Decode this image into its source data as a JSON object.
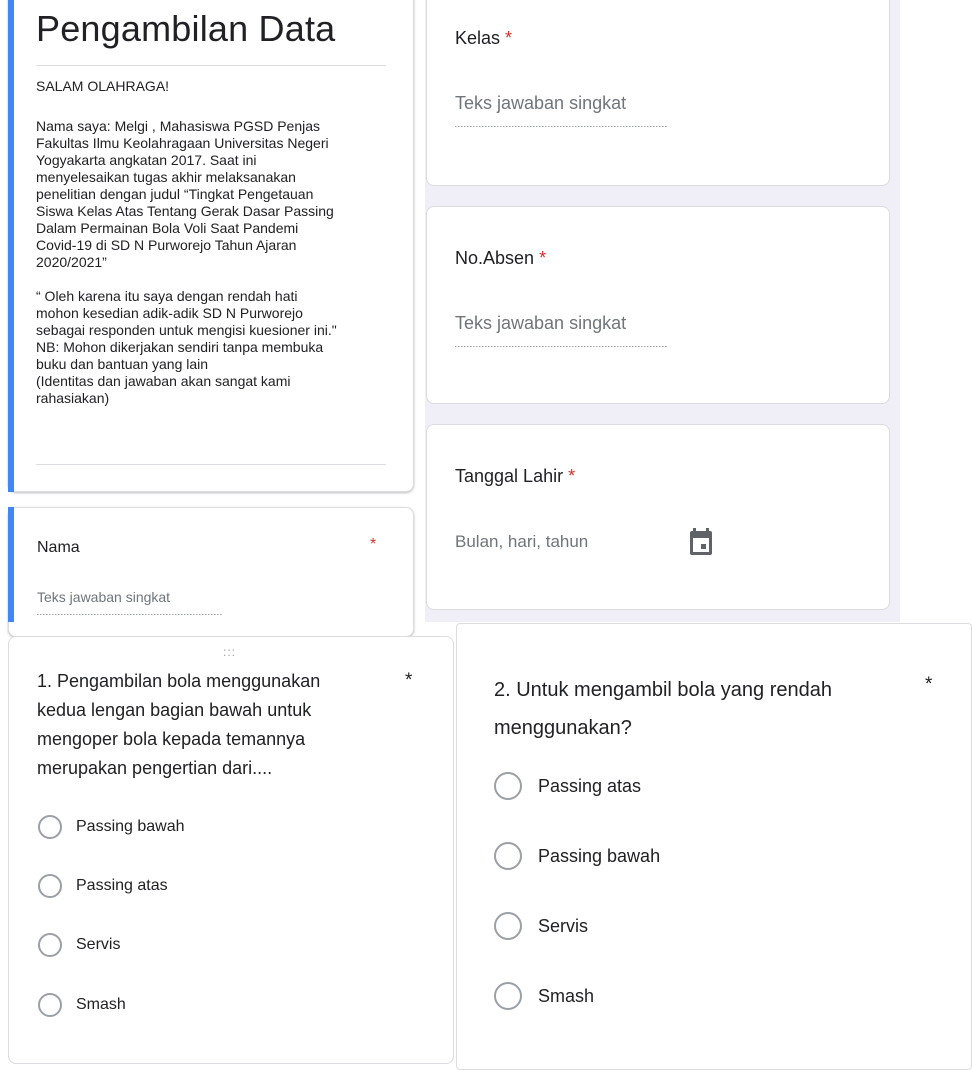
{
  "form": {
    "title": "Pengambilan Data",
    "greeting": "SALAM OLAHRAGA!",
    "description": "Nama saya: Melgi , Mahasiswa PGSD Penjas\nFakultas Ilmu Keolahragaan Universitas Negeri\nYogyakarta angkatan 2017. Saat ini\nmenyelesaikan tugas akhir melaksanakan\npenelitian dengan judul “Tingkat Pengetauan\nSiswa Kelas Atas Tentang Gerak Dasar Passing\nDalam Permainan Bola Voli Saat Pandemi\nCovid-19 di SD N Purworejo Tahun Ajaran\n2020/2021”\n\n“ Oleh karena itu saya dengan rendah hati\nmohon kesedian adik-adik SD N Purworejo\nsebagai responden untuk mengisi kuesioner ini.\"\nNB: Mohon dikerjakan sendiri tanpa membuka\nbuku dan bantuan yang lain\n(Identitas dan jawaban akan sangat kami\nrahasiakan)"
  },
  "fields": {
    "nama": {
      "label": "Nama",
      "required": "*",
      "placeholder": "Teks jawaban singkat"
    },
    "kelas": {
      "label": "Kelas",
      "required": "*",
      "placeholder": "Teks jawaban singkat"
    },
    "absen": {
      "label": "No.Absen",
      "required": "*",
      "placeholder": "Teks jawaban singkat"
    },
    "tanggal": {
      "label": "Tanggal Lahir",
      "required": "*",
      "placeholder": "Bulan, hari, tahun",
      "icon": "calendar-icon"
    }
  },
  "questions": [
    {
      "text": "1. Pengambilan bola menggunakan\nkedua lengan bagian bawah untuk\nmengoper bola kepada temannya\nmerupakan pengertian dari....",
      "required": "*",
      "drag_handle": ":::",
      "options": [
        "Passing bawah",
        "Passing atas",
        "Servis",
        "Smash"
      ]
    },
    {
      "text": "2. Untuk mengambil bola yang rendah\nmenggunakan?",
      "required": "*",
      "options": [
        "Passing atas",
        "Passing bawah",
        "Servis",
        "Smash"
      ]
    }
  ],
  "colors": {
    "accent": "#4285f4",
    "required": "#d93025",
    "background": "#f0eff8"
  }
}
